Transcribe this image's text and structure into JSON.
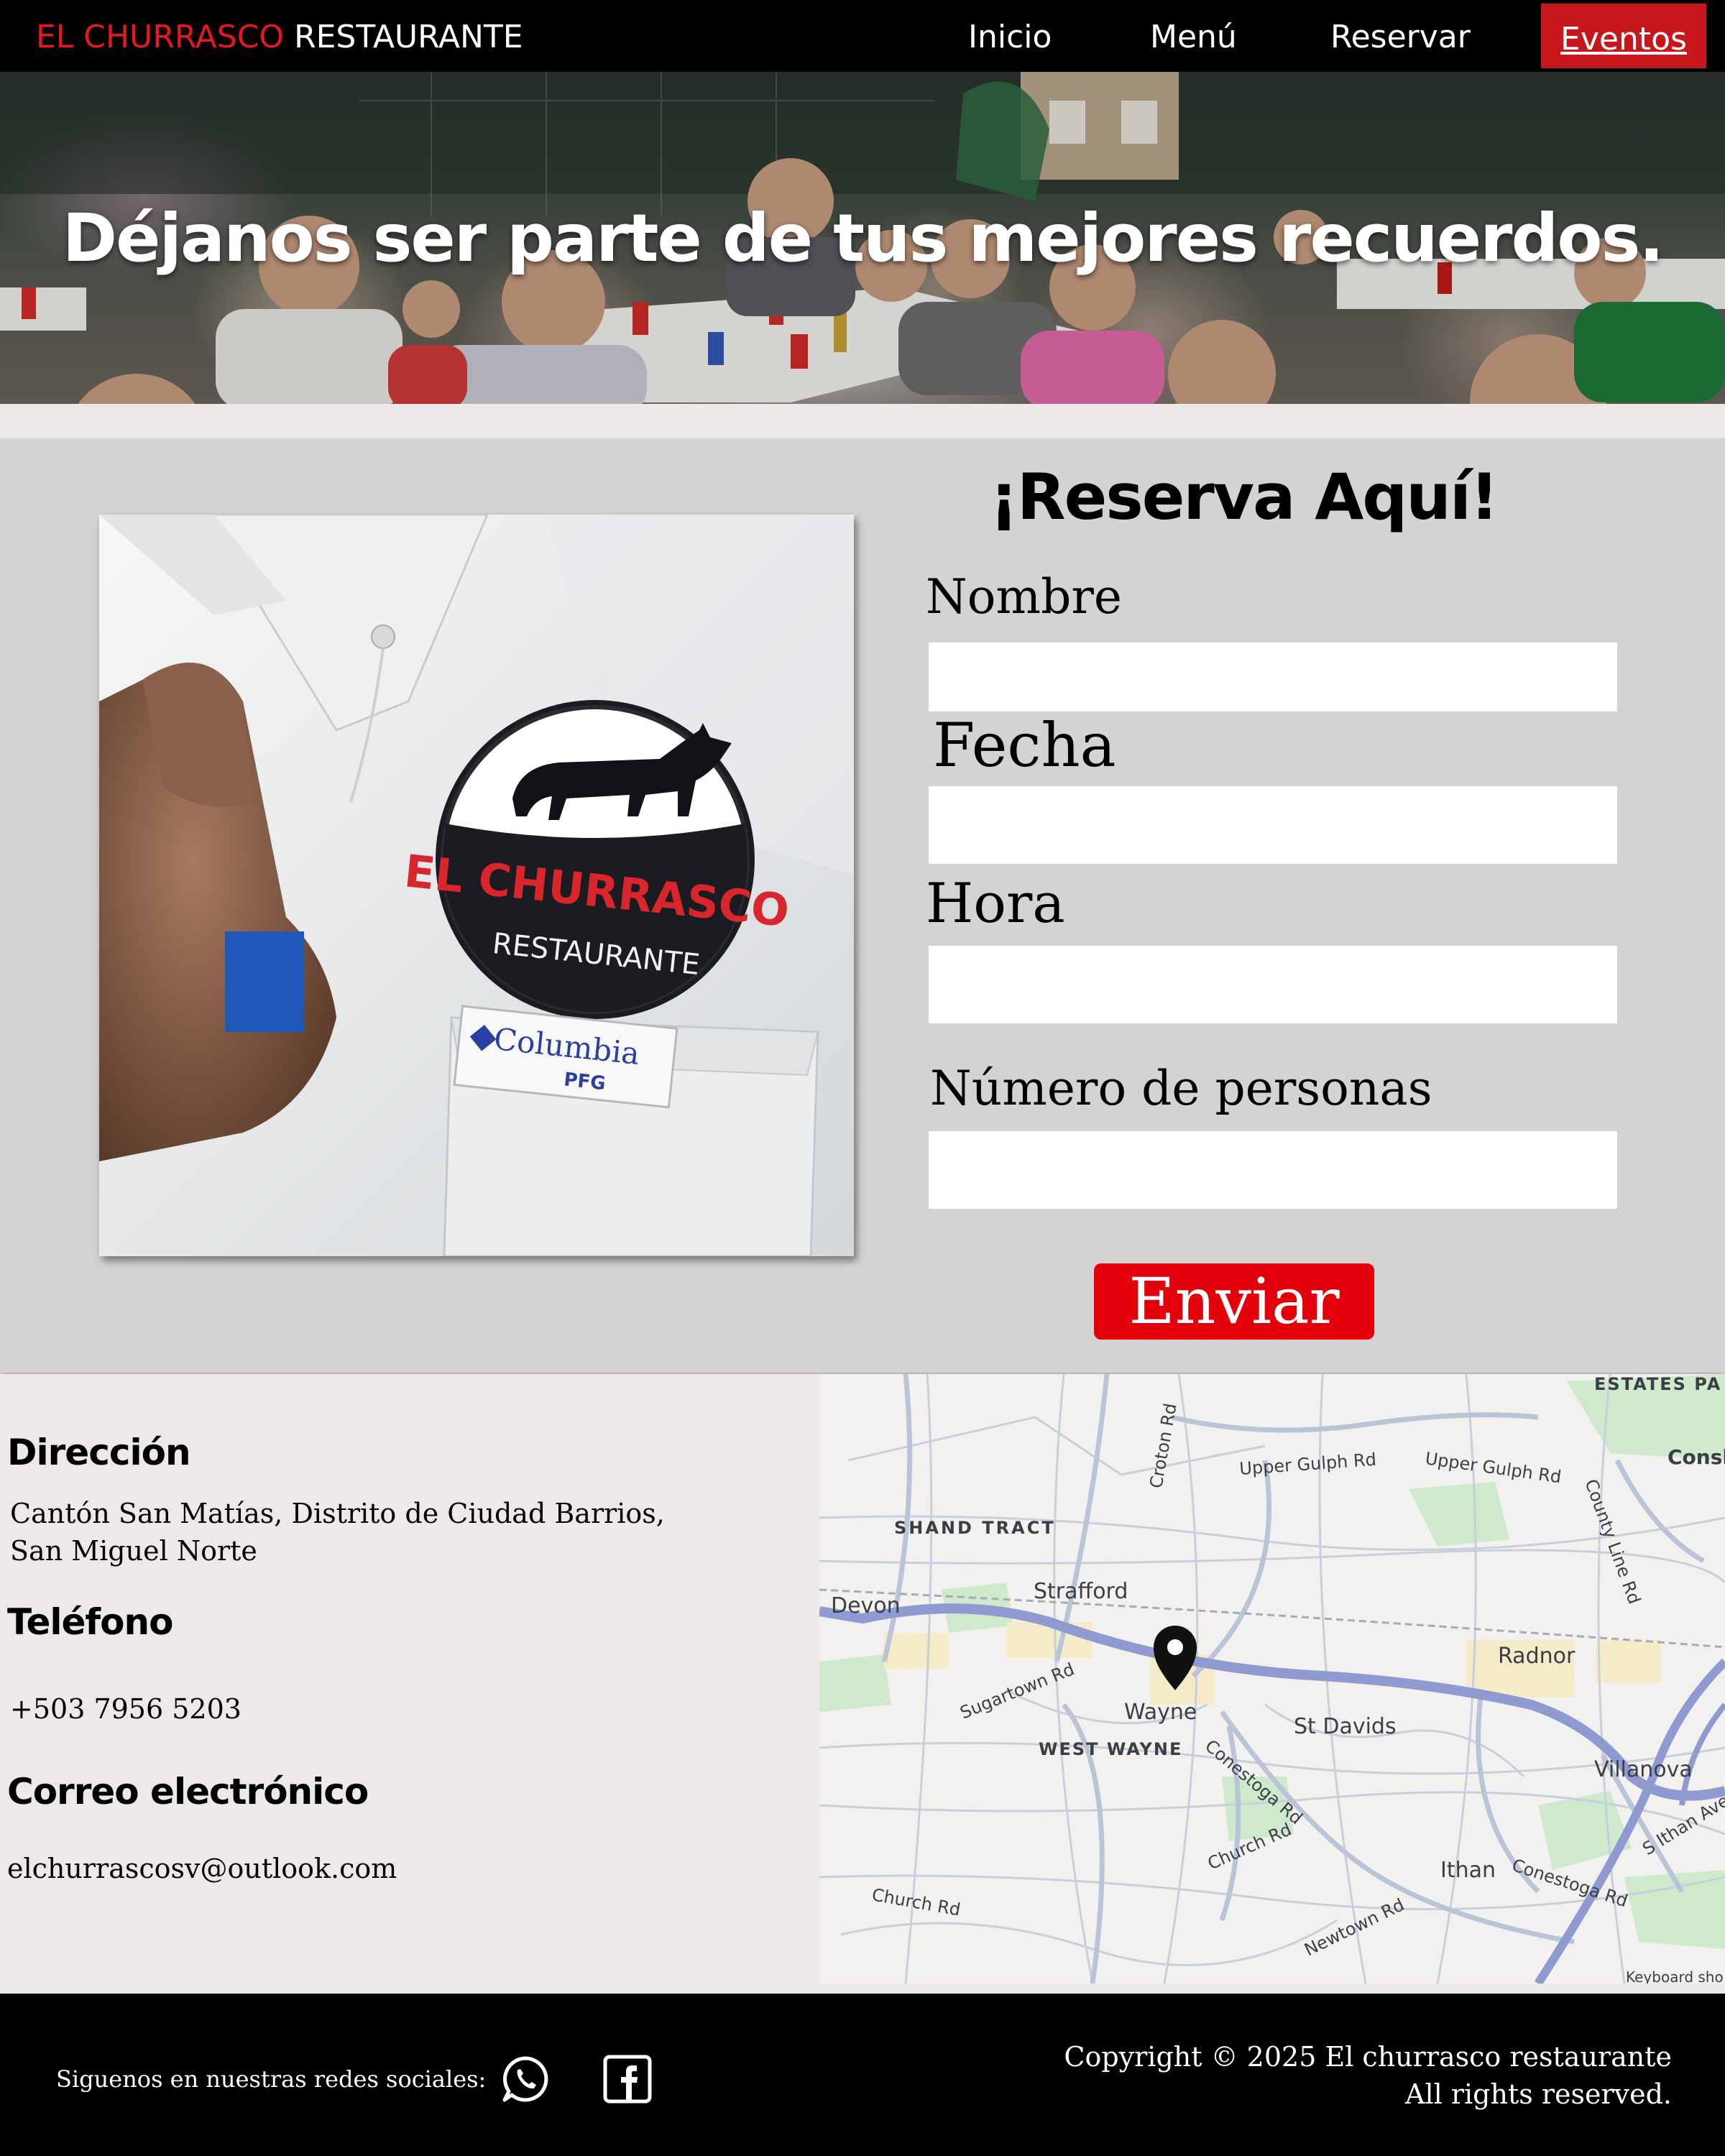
{
  "nav": {
    "brand_part1": "EL CHURRASCO",
    "brand_part2": "RESTAURANTE",
    "links": [
      "Inicio",
      "Menú",
      "Reservar"
    ],
    "active_link": "Eventos",
    "accent_color": "#c8161d"
  },
  "hero": {
    "title": "Déjanos ser parte de tus mejores recuerdos."
  },
  "reservation": {
    "title": "¡Reserva Aquí!",
    "photo_icon": "shirt-logo-photo",
    "fields": [
      {
        "label": "Nombre",
        "value": ""
      },
      {
        "label": "Fecha",
        "value": ""
      },
      {
        "label": "Hora",
        "value": ""
      },
      {
        "label": "Número de personas",
        "value": ""
      }
    ],
    "submit_label": "Enviar",
    "submit_color": "#e4000b"
  },
  "contact": {
    "address_heading": "Dirección",
    "address_line1": "Cantón San Matías, Distrito de Ciudad Barrios,",
    "address_line2": "San Miguel Norte",
    "phone_heading": "Teléfono",
    "phone": "+503 7956 5203",
    "email_heading": "Correo electrónico",
    "email": "elchurrascosv@outlook.com"
  },
  "map": {
    "labels": [
      "ESTATES PA",
      "Upper Gulph Rd",
      "Upper Gulph Rd",
      "Consh",
      "County Line Rd",
      "SHAND TRACT",
      "Croton Rd",
      "Devon",
      "Strafford",
      "Radnor",
      "Sugartown Rd",
      "Wayne",
      "St Davids",
      "WEST WAYNE",
      "Conestoga Rd",
      "Villanova",
      "Church Rd",
      "Ithan",
      "Conestoga Rd",
      "S Ithan Ave",
      "Church Rd",
      "Newtown Rd",
      "Keyboard sho"
    ],
    "marker_icon": "map-pin-icon"
  },
  "footer": {
    "social_label": "Siguenos en nuestras redes sociales:",
    "social_icons": [
      "whatsapp-icon",
      "facebook-icon"
    ],
    "copyright_line1": "Copyright © 2025 El churrasco restaurante",
    "copyright_line2": "All rights reserved."
  }
}
